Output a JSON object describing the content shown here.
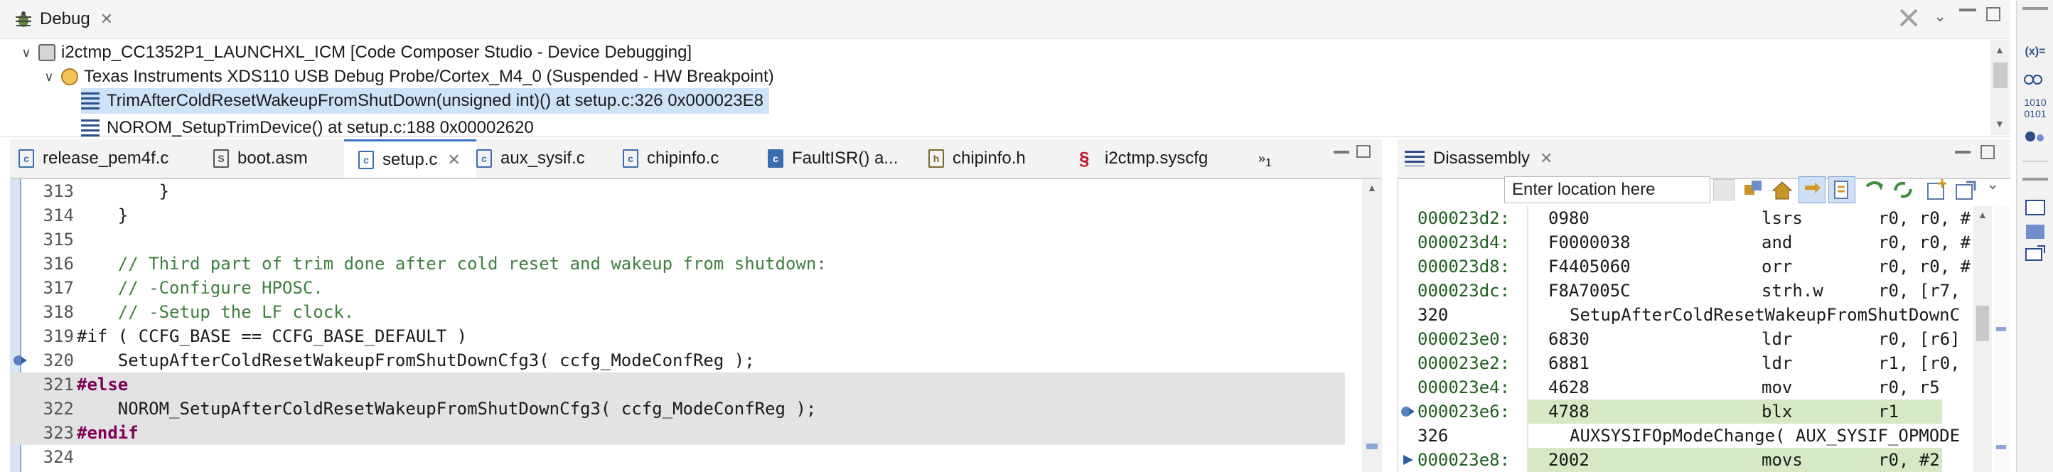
{
  "debug": {
    "tab_label": "Debug",
    "tree": [
      {
        "label": "i2ctmp_CC1352P1_LAUNCHXL_ICM [Code Composer Studio - Device Debugging]"
      },
      {
        "label": "Texas Instruments XDS110 USB Debug Probe/Cortex_M4_0 (Suspended - HW Breakpoint)"
      },
      {
        "label": "TrimAfterColdResetWakeupFromShutDown(unsigned int)() at setup.c:326 0x000023E8"
      },
      {
        "label": "NOROM_SetupTrimDevice() at setup.c:188 0x00002620"
      }
    ]
  },
  "editor": {
    "tabs": [
      {
        "label": "release_pem4f.c"
      },
      {
        "label": "boot.asm"
      },
      {
        "label": "setup.c"
      },
      {
        "label": "aux_sysif.c"
      },
      {
        "label": "chipinfo.c"
      },
      {
        "label": "FaultISR() a..."
      },
      {
        "label": "chipinfo.h"
      },
      {
        "label": "i2ctmp.syscfg"
      }
    ],
    "overflow_count": "1",
    "lines": [
      {
        "num": "313",
        "text": "        }"
      },
      {
        "num": "314",
        "text": "    }"
      },
      {
        "num": "315",
        "text": ""
      },
      {
        "num": "316",
        "text": "    // Third part of trim done after cold reset and wakeup from shutdown:"
      },
      {
        "num": "317",
        "text": "    // -Configure HPOSC."
      },
      {
        "num": "318",
        "text": "    // -Setup the LF clock."
      },
      {
        "num": "319",
        "text": "#if ( CCFG_BASE == CCFG_BASE_DEFAULT )"
      },
      {
        "num": "320",
        "text": "    SetupAfterColdResetWakeupFromShutDownCfg3( ccfg_ModeConfReg );"
      },
      {
        "num": "321",
        "text": "#else"
      },
      {
        "num": "322",
        "text": "    NOROM_SetupAfterColdResetWakeupFromShutDownCfg3( ccfg_ModeConfReg );"
      },
      {
        "num": "323",
        "text": "#endif"
      },
      {
        "num": "324",
        "text": ""
      }
    ]
  },
  "disassembly": {
    "tab_label": "Disassembly",
    "location_placeholder": "Enter location here",
    "lines": [
      {
        "addr": "000023d2:",
        "op": "0980",
        "mnem": "lsrs",
        "args": "r0, r0, #"
      },
      {
        "addr": "000023d4:",
        "op": "F0000038",
        "mnem": "and",
        "args": "r0, r0, #"
      },
      {
        "addr": "000023d8:",
        "op": "F4405060",
        "mnem": "orr",
        "args": "r0, r0, #"
      },
      {
        "addr": "000023dc:",
        "op": "F8A7005C",
        "mnem": "strh.w",
        "args": "r0, [r7,"
      },
      {
        "addr": "320",
        "op": "SetupAfterColdResetWakeupFromShutDownC",
        "mnem": "",
        "args": ""
      },
      {
        "addr": "000023e0:",
        "op": "6830",
        "mnem": "ldr",
        "args": "r0, [r6]"
      },
      {
        "addr": "000023e2:",
        "op": "6881",
        "mnem": "ldr",
        "args": "r1, [r0,"
      },
      {
        "addr": "000023e4:",
        "op": "4628",
        "mnem": "mov",
        "args": "r0, r5"
      },
      {
        "addr": "000023e6:",
        "op": "4788",
        "mnem": "blx",
        "args": "r1"
      },
      {
        "addr": "326",
        "op": "AUXSYSIFOpModeChange( AUX_SYSIF_OPMODE",
        "mnem": "",
        "args": ""
      },
      {
        "addr": "000023e8:",
        "op": "2002",
        "mnem": "movs",
        "args": "r0, #2"
      }
    ]
  },
  "right_rail": {
    "items": [
      "(x)=",
      "1010\n0101"
    ]
  },
  "colors": {
    "selection": "#cfe3f8",
    "grey_block": "#e3e3e3",
    "comment": "#3f7f3f",
    "keyword": "#7f0055",
    "disasm_highlight": "#d6e8c4"
  }
}
